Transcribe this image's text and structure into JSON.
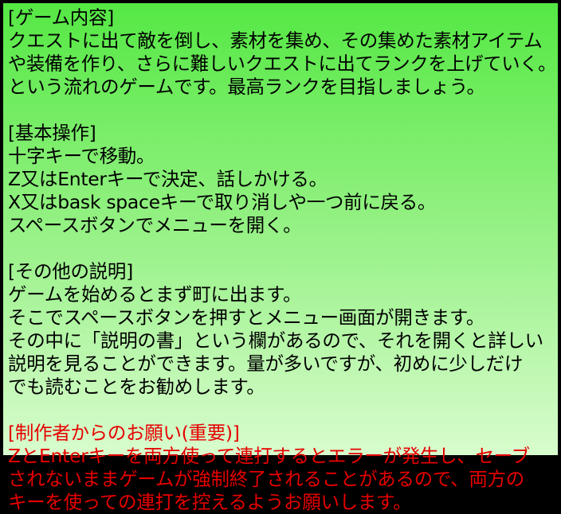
{
  "colors": {
    "text": "#000000",
    "warning_text": "#e60000",
    "background_top": "#55e844",
    "background_bottom": "#d8fccd",
    "frame": "#000000"
  },
  "sections": {
    "content": {
      "heading": "[ゲーム内容]",
      "lines": [
        "クエストに出て敵を倒し、素材を集め、その集めた素材アイテム",
        "や装備を作り、さらに難しいクエストに出てランクを上げていく。",
        "という流れのゲームです。最高ランクを目指しましょう。"
      ]
    },
    "controls": {
      "heading": "[基本操作]",
      "lines": [
        "十字キーで移動。",
        "Z又はEnterキーで決定、話しかける。",
        "X又はbask spaceキーで取り消しや一つ前に戻る。",
        "スペースボタンでメニューを開く。"
      ]
    },
    "other": {
      "heading": "[その他の説明]",
      "lines": [
        "ゲームを始めるとまず町に出ます。",
        "そこでスペースボタンを押すとメニュー画面が開きます。",
        "その中に「説明の書」という欄があるので、それを開くと詳しい",
        "説明を見ることができます。量が多いですが、初めに少しだけ",
        "でも読むことをお勧めします。"
      ]
    },
    "request": {
      "heading": "[制作者からのお願い(重要)]",
      "lines": [
        "ZとEnterキーを両方使って連打するとエラーが発生し、セーブ",
        "されないままゲームが強制終了されることがあるので、両方の",
        "キーを使っての連打を控えるようお願いします。"
      ]
    }
  }
}
